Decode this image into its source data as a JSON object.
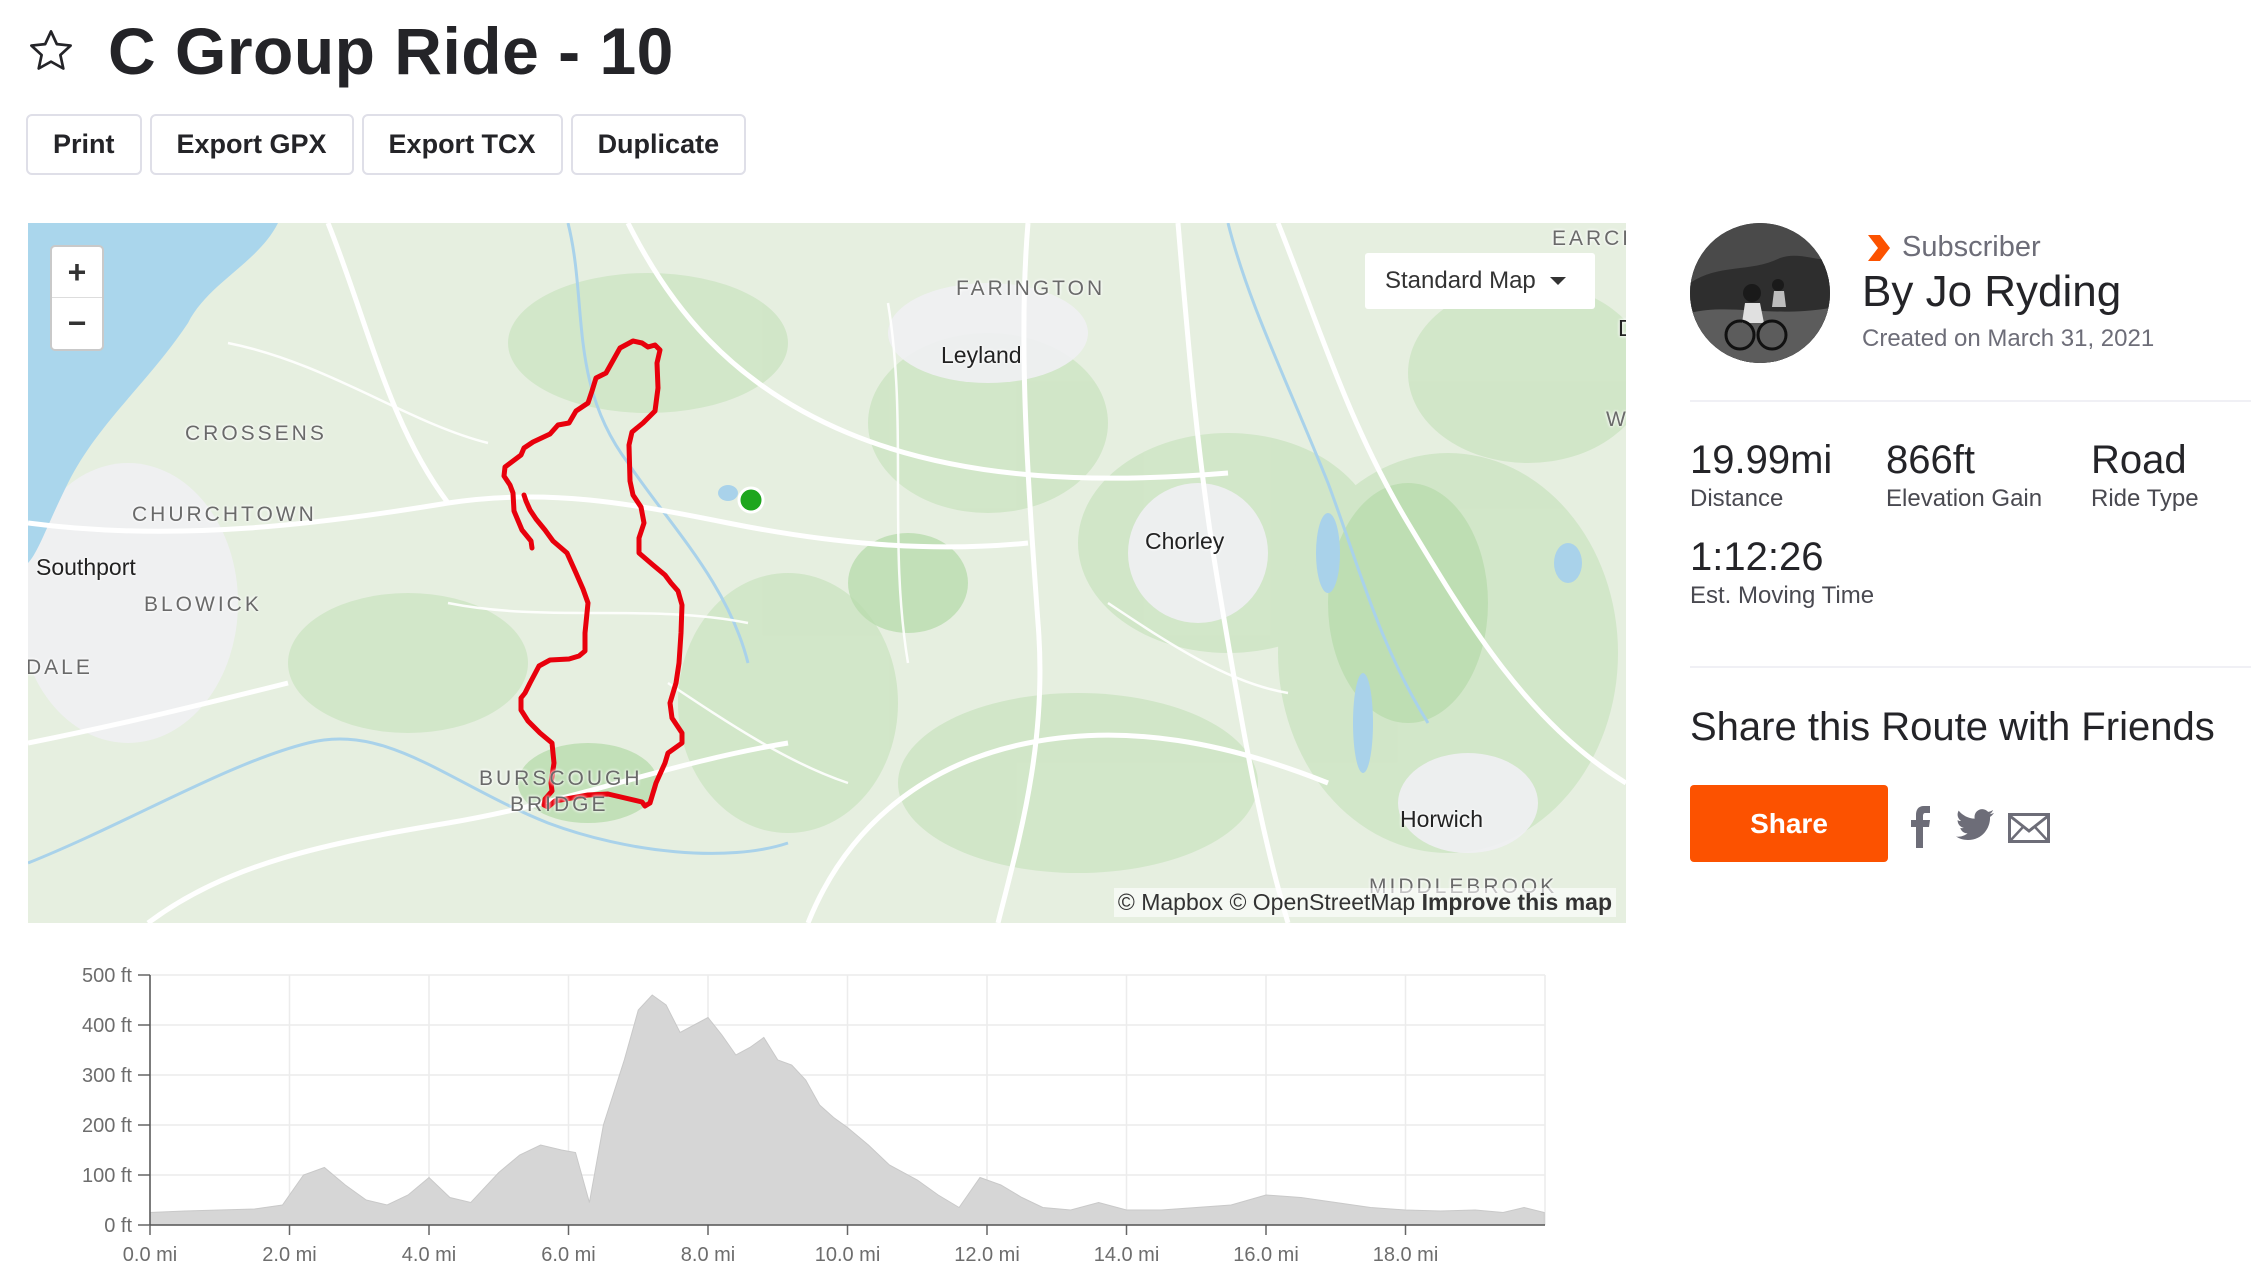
{
  "route": {
    "title": "C Group Ride - 10"
  },
  "toolbar": {
    "print": "Print",
    "export_gpx": "Export GPX",
    "export_tcx": "Export TCX",
    "duplicate": "Duplicate"
  },
  "map": {
    "zoom_in": "+",
    "zoom_out": "−",
    "map_type": "Standard Map",
    "attribution_mapbox": "© Mapbox",
    "attribution_osm": "© OpenStreetMap",
    "attribution_improve": "Improve this map",
    "places": {
      "farington": "FARINGTON",
      "leyland": "Leyland",
      "crossens": "CROSSENS",
      "churchtown": "CHURCHTOWN",
      "southport": "Southport",
      "blowick": "BLOWICK",
      "dale": "DALE",
      "chorley": "Chorley",
      "burscough_bridge_1": "BURSCOUGH",
      "burscough_bridge_2": "BRIDGE",
      "horwich": "Horwich",
      "middlebrook": "MIDDLEBROOK",
      "earcr": "EARCR",
      "edge_d": "D",
      "edge_w": "W"
    },
    "colors": {
      "route": "#e8000c",
      "start_marker": "#1ea61e",
      "water": "#a9d6ec",
      "land": "#e4efdc"
    }
  },
  "author": {
    "badge": "Subscriber",
    "byline": "By Jo Ryding",
    "created": "Created on March 31, 2021"
  },
  "stats": {
    "distance": {
      "value": "19.99mi",
      "label": "Distance"
    },
    "elevation": {
      "value": "866ft",
      "label": "Elevation Gain"
    },
    "ride_type": {
      "value": "Road",
      "label": "Ride Type"
    },
    "moving_time": {
      "value": "1:12:26",
      "label": "Est. Moving Time"
    }
  },
  "share": {
    "title": "Share this Route with Friends",
    "button": "Share",
    "icons": [
      "facebook-icon",
      "twitter-icon",
      "email-icon"
    ]
  },
  "accent_color": "#fc5200",
  "chart_data": {
    "type": "area",
    "title": "",
    "xlabel": "",
    "ylabel": "",
    "xlim": [
      0,
      20
    ],
    "ylim": [
      0,
      500
    ],
    "y_ticks": [
      "0 ft",
      "100 ft",
      "200 ft",
      "300 ft",
      "400 ft",
      "500 ft"
    ],
    "x_ticks": [
      "0.0 mi",
      "2.0 mi",
      "4.0 mi",
      "6.0 mi",
      "8.0 mi",
      "10.0 mi",
      "12.0 mi",
      "14.0 mi",
      "16.0 mi",
      "18.0 mi"
    ],
    "grid": true,
    "fill_color": "#d6d6d6",
    "x": [
      0.0,
      0.5,
      1.0,
      1.5,
      1.9,
      2.2,
      2.5,
      2.8,
      3.1,
      3.4,
      3.7,
      4.0,
      4.3,
      4.6,
      5.0,
      5.3,
      5.6,
      5.9,
      6.1,
      6.3,
      6.5,
      6.8,
      7.0,
      7.2,
      7.4,
      7.6,
      7.8,
      8.0,
      8.2,
      8.4,
      8.6,
      8.8,
      9.0,
      9.2,
      9.4,
      9.6,
      9.8,
      10.0,
      10.3,
      10.6,
      11.0,
      11.3,
      11.6,
      11.9,
      12.2,
      12.5,
      12.8,
      13.2,
      13.6,
      14.0,
      14.5,
      15.0,
      15.5,
      16.0,
      16.5,
      17.0,
      17.5,
      18.0,
      18.5,
      19.0,
      19.4,
      19.7,
      19.99
    ],
    "y": [
      25,
      28,
      30,
      32,
      40,
      100,
      115,
      80,
      50,
      40,
      60,
      95,
      55,
      45,
      105,
      140,
      160,
      150,
      145,
      45,
      200,
      330,
      430,
      460,
      440,
      385,
      400,
      415,
      380,
      340,
      355,
      375,
      330,
      320,
      290,
      240,
      215,
      195,
      160,
      120,
      90,
      60,
      35,
      95,
      80,
      55,
      35,
      30,
      45,
      30,
      30,
      35,
      40,
      60,
      55,
      45,
      35,
      30,
      28,
      30,
      25,
      35,
      25
    ]
  }
}
